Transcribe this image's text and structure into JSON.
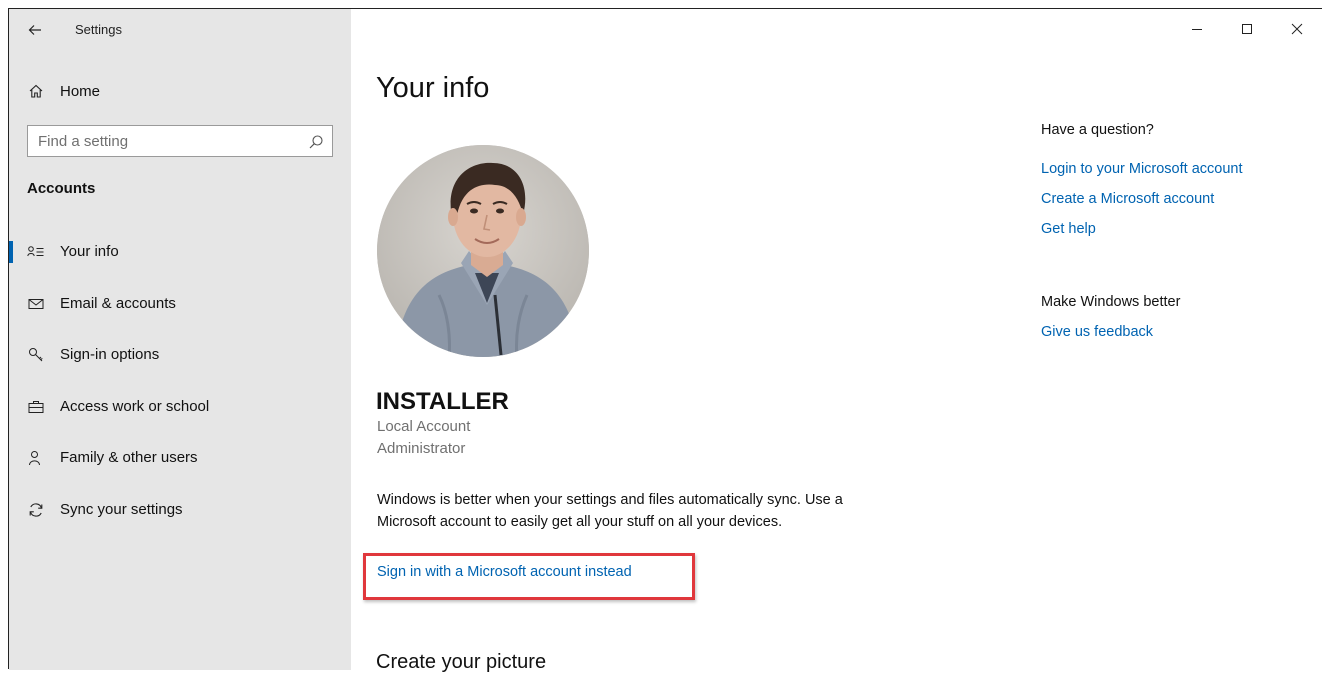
{
  "window": {
    "title": "Settings"
  },
  "sidebar": {
    "home_label": "Home",
    "search": {
      "placeholder": "Find a setting"
    },
    "section_title": "Accounts",
    "items": [
      {
        "label": "Your info",
        "icon": "person-info-icon",
        "active": true
      },
      {
        "label": "Email & accounts",
        "icon": "mail-icon",
        "active": false
      },
      {
        "label": "Sign-in options",
        "icon": "key-icon",
        "active": false
      },
      {
        "label": "Access work or school",
        "icon": "briefcase-icon",
        "active": false
      },
      {
        "label": "Family & other users",
        "icon": "person-add-icon",
        "active": false
      },
      {
        "label": "Sync your settings",
        "icon": "sync-icon",
        "active": false
      }
    ]
  },
  "main": {
    "title": "Your info",
    "user": {
      "name": "INSTALLER",
      "account_type": "Local Account",
      "role": "Administrator"
    },
    "sync_message": "Windows is better when your settings and files automatically sync. Use a Microsoft account to easily get all your stuff on all your devices.",
    "signin_link": "Sign in with a Microsoft account instead",
    "create_picture_heading": "Create your picture"
  },
  "help": {
    "question_heading": "Have a question?",
    "links": [
      "Login to your Microsoft account",
      "Create a Microsoft account",
      "Get help"
    ],
    "better_heading": "Make Windows better",
    "feedback_link": "Give us feedback"
  },
  "colors": {
    "accent": "#0063b1",
    "sidebar_bg": "#e6e6e6",
    "highlight_box": "#e0373c"
  }
}
